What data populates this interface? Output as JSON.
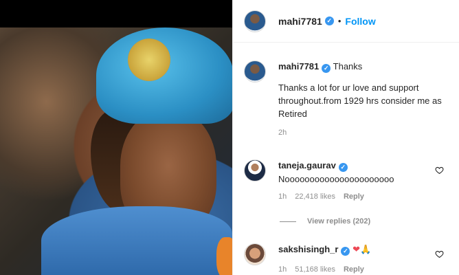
{
  "post": {
    "author": "mahi7781",
    "follow_label": "Follow",
    "separator": "•"
  },
  "caption": {
    "author": "mahi7781",
    "title": "Thanks",
    "text": "Thanks a lot for ur love and support throughout.from 1929 hrs consider me as Retired",
    "time": "2h"
  },
  "comments": [
    {
      "author": "taneja.gaurav",
      "verified": true,
      "text": "Noooooooooooooooooooooo",
      "time": "1h",
      "likes": "22,418 likes",
      "reply_label": "Reply",
      "view_replies": "View replies (202)"
    },
    {
      "author": "sakshisingh_r",
      "verified": true,
      "text": "❤🙏",
      "time": "1h",
      "likes": "51,168 likes",
      "reply_label": "Reply"
    }
  ],
  "icons": {
    "verified": "verified-badge-icon",
    "like": "heart-outline-icon"
  },
  "colors": {
    "accent": "#0095f6",
    "verified": "#3897f0",
    "muted": "#8e8e8e"
  }
}
